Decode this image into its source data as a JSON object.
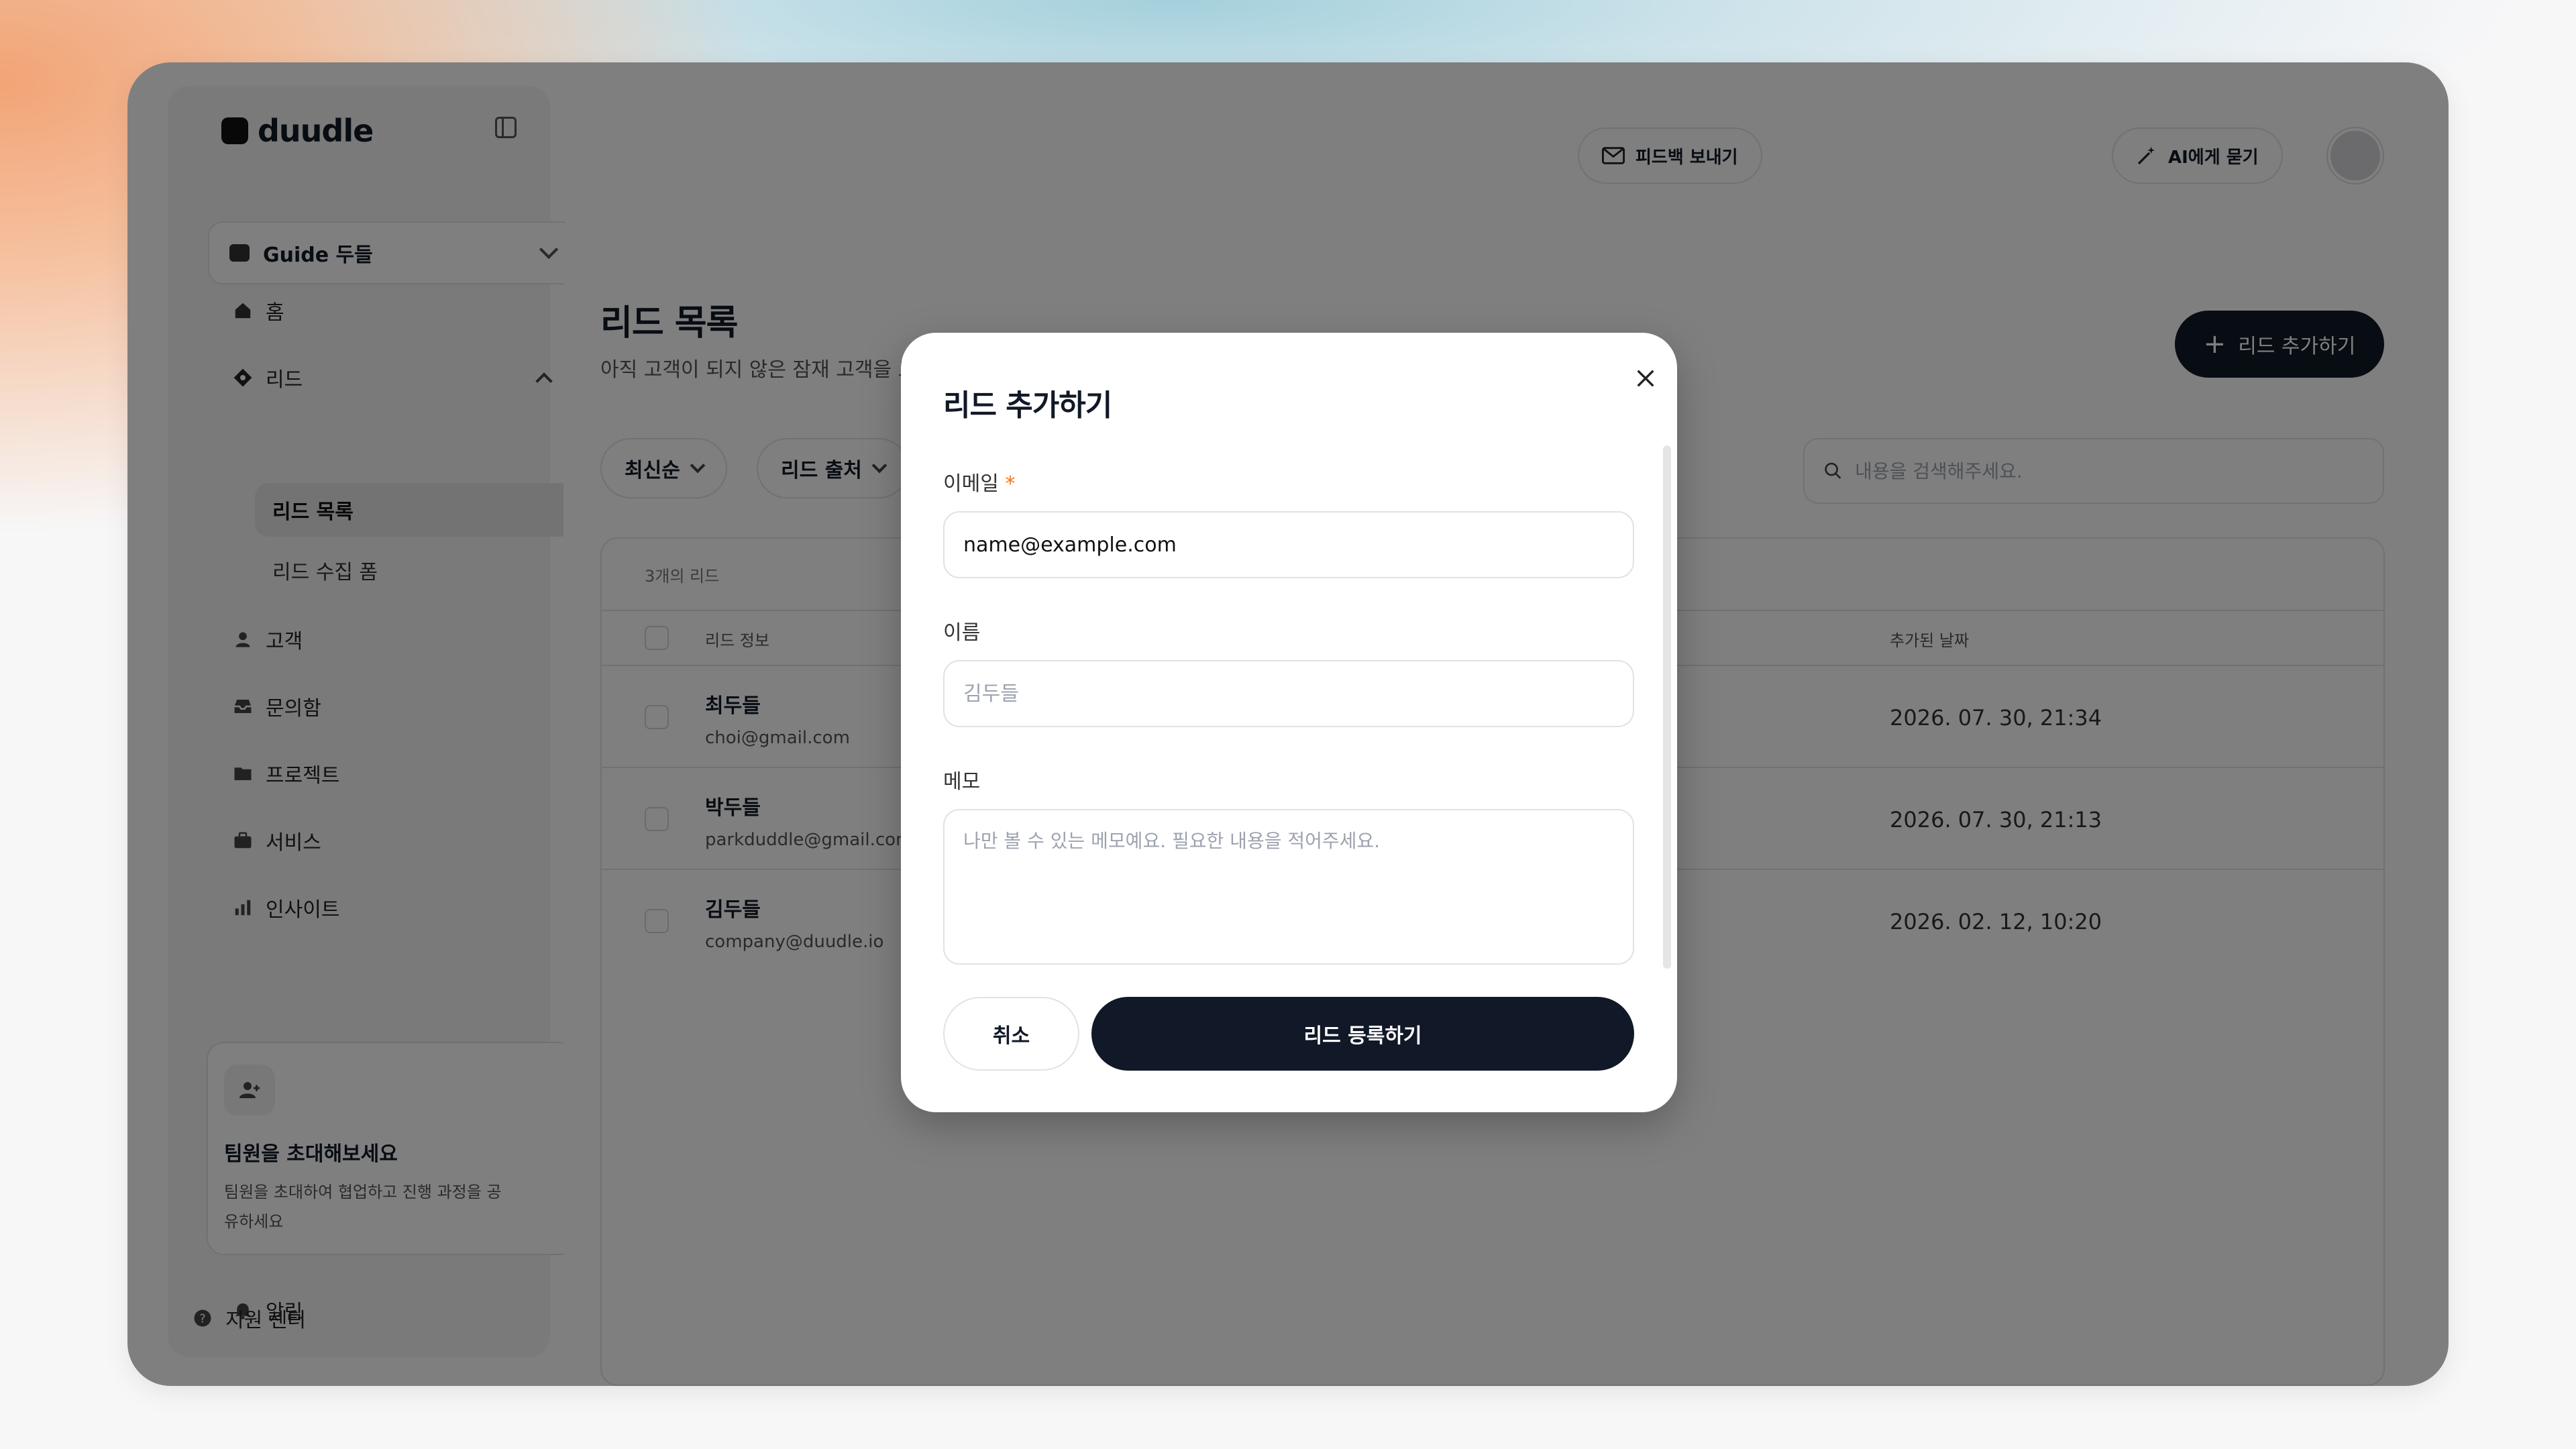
{
  "app": {
    "logo_text": "duudle"
  },
  "sidebar": {
    "workspace": "Guide 두들",
    "items": {
      "home": "홈",
      "leads": "리드",
      "lead_list": "리드 목록",
      "lead_form": "리드 수집 폼",
      "customers": "고객",
      "inbox": "문의함",
      "projects": "프로젝트",
      "services": "서비스",
      "insights": "인사이트",
      "notifications": "알림",
      "support": "지원 센터"
    },
    "invite": {
      "title": "팀원을 초대해보세요",
      "desc": "팀원을 초대하여 협업하고 진행 과정을 공유하세요"
    }
  },
  "header": {
    "feedback": "피드백 보내기",
    "ask_ai": "AI에게 묻기"
  },
  "page": {
    "title": "리드 목록",
    "desc": "아직 고객이 되지 않은 잠재 고객을 모아 관리해요.",
    "add_button": "리드 추가하기",
    "filters": {
      "sort": "최신순",
      "source": "리드 출처"
    },
    "search_placeholder": "내용을 검색해주세요."
  },
  "table": {
    "count": "3개의 리드",
    "col_info": "리드 정보",
    "col_date": "추가된 날짜",
    "rows": [
      {
        "name": "최두들",
        "email": "choi@gmail.com",
        "date": "2026. 07. 30, 21:34"
      },
      {
        "name": "박두들",
        "email": "parkduddle@gmail.com",
        "date": "2026. 07. 30, 21:13"
      },
      {
        "name": "김두들",
        "email": "company@duudle.io",
        "date": "2026. 02. 12, 10:20"
      }
    ]
  },
  "modal": {
    "title": "리드 추가하기",
    "email_label": "이메일",
    "required_mark": "*",
    "email_value": "name@example.com",
    "name_label": "이름",
    "name_placeholder": "김두들",
    "memo_label": "메모",
    "memo_placeholder": "나만 볼 수 있는 메모예요. 필요한 내용을 적어주세요.",
    "cancel": "취소",
    "submit": "리드 등록하기"
  },
  "colors": {
    "primary": "#111827",
    "required": "#f97316",
    "overlay": "rgba(0,0,0,0.5)"
  }
}
